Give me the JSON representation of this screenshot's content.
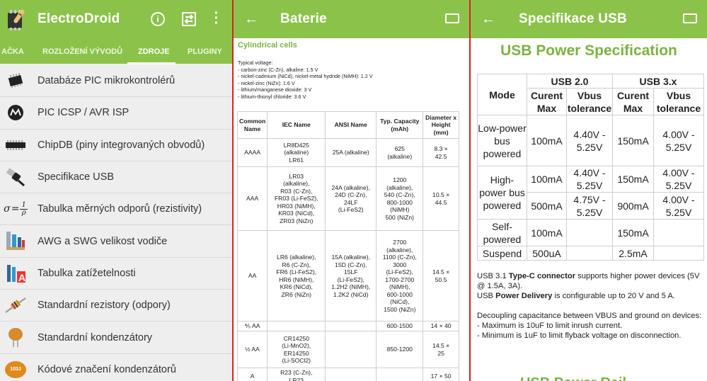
{
  "panel1": {
    "title": "ElectroDroid",
    "tabs": [
      "AČKA",
      "ROZLOŽENÍ VÝVODŮ",
      "ZDROJE",
      "PLUGINY"
    ],
    "active_tab": "ZDROJE",
    "items": [
      {
        "label": "Databáze PIC mikrokontrolérů",
        "icon": "microcontroller-chip-icon"
      },
      {
        "label": "PIC ICSP / AVR ISP",
        "icon": "microchip-logo-icon"
      },
      {
        "label": "ChipDB (piny integrovaných obvodů)",
        "icon": "ic-chip-icon"
      },
      {
        "label": "Specifikace USB",
        "icon": "usb-plug-icon"
      },
      {
        "label": "Tabulka měrných odporů (rezistivity)",
        "icon": "resistivity-formula-icon"
      },
      {
        "label": "AWG a SWG velikost vodiče",
        "icon": "wire-gauge-icon"
      },
      {
        "label": "Tabulka zatížetelnosti",
        "icon": "ampacity-wires-icon"
      },
      {
        "label": "Standardní rezistory (odpory)",
        "icon": "resistor-icon"
      },
      {
        "label": "Standardní kondenzátory",
        "icon": "ceramic-capacitor-icon"
      },
      {
        "label": "Kódové značení kondenzátorů",
        "icon": "capacitor-code-icon"
      }
    ],
    "formula": {
      "sigma": "σ",
      "eq": "=",
      "num": "1",
      "den": "ρ"
    },
    "cap_code": "103J"
  },
  "panel2": {
    "title": "Baterie",
    "section": "Cylindrical cells",
    "voltage_heading": "Typical voltage:",
    "voltages": [
      "- carbon-zinc (C-Zn), alkaline: 1.5 V",
      "- nickel-cadmium (NiCd), nickel-metal hydride (NiMH): 1.2 V",
      "- nickel-zinc (NiZn): 1.6 V",
      "- lithium/manganese dioxide: 3 V",
      "- lithium-thionyl chloride: 3.6 V"
    ],
    "headers": [
      "Common Name",
      "IEC Name",
      "ANSI Name",
      "Typ. Capacity (mAh)",
      "Diameter x Height (mm)"
    ],
    "rows": [
      [
        "AAAA",
        "LR8D425\n(alkaline)\nLR61",
        "25A (alkaline)",
        "625\n(alkaline)",
        "8.3 ×\n42.5"
      ],
      [
        "AAA",
        "LR03\n(alkaline),\nR03 (C-Zn),\nFR03 (Li-FeS2),\nHR03 (NiMH),\nKR03 (NiCd),\nZR03 (NiZn)",
        "24A (alkaline),\n24D (C-Zn),\n24LF\n(Li-FeS2)",
        "1200\n(alkaline),\n540 (C-Zn),\n800-1000\n(NiMH)\n500 (NiZn)",
        "10.5 ×\n44.5"
      ],
      [
        "AA",
        "LR6 (alkaline),\nR6 (C-Zn),\nFR6 (Li-FeS2),\nHR6 (NiMH),\nKR6 (NiCd),\nZR6 (NiZn)",
        "15A (alkaline),\n15D (C-Zn),\n15LF\n(Li-FeS2),\n1.2H2 (NiMH),\n1.2K2 (NiCd)",
        "2700\n(alkaline),\n1100 (C-Zn),\n3000\n(Li-FeS2),\n1700-2700\n(NiMH),\n600-1000\n(NiCd),\n1500 (NiZn)",
        "14.5 ×\n50.5"
      ],
      [
        "⅘ AA",
        "",
        "",
        "600-1500",
        "14 × 40"
      ],
      [
        "½ AA",
        "CR14250\n(Li-MnO2),\nER14250\n(Li-SOCl2)",
        "",
        "850-1200",
        "14.5 ×\n25"
      ],
      [
        "A",
        "R23 (C-Zn),\nLR23",
        "",
        "",
        "17 × 50"
      ]
    ],
    "zoom_out": "−",
    "zoom_in": "+"
  },
  "panel3": {
    "title": "Specifikace USB",
    "heading": "USB Power Specification",
    "h_mode": "Mode",
    "h_usb2": "USB 2.0",
    "h_usb3": "USB 3.x",
    "h_cur": "Curent Max",
    "h_vbus": "Vbus tolerance",
    "rows": [
      {
        "mode": "Low-power bus powered",
        "c2": "100mA",
        "v2": "4.40V - 5.25V",
        "c3": "150mA",
        "v3": "4.00V - 5.25V"
      },
      {
        "mode": "High-power bus powered",
        "c2": "100mA",
        "v2": "4.40V - 5.25V",
        "c3": "150mA",
        "v3": "4.00V - 5.25V"
      },
      {
        "mode": "",
        "c2": "500mA",
        "v2": "4.75V - 5.25V",
        "c3": "900mA",
        "v3": "4.00V - 5.25V"
      },
      {
        "mode": "Self-powered",
        "c2": "100mA",
        "v2": "",
        "c3": "150mA",
        "v3": ""
      },
      {
        "mode": "Suspend",
        "c2": "500uA",
        "v2": "",
        "c3": "2.5mA",
        "v3": ""
      }
    ],
    "note1a": "USB 3.1 ",
    "note1b": "Type-C connector",
    "note1c": " supports higher power devices (5V @ 1.5A, 3A).",
    "note2a": "USB ",
    "note2b": "Power Delivery",
    "note2c": " is configurable up to 20 V and 5 A.",
    "note3": "Decoupling capacitance between VBUS and ground on devices:",
    "note4": "- Maximum is 10uF to limit inrush current.",
    "note5": "- Minimum is 1uF to limit flyback voltage on disconnection.",
    "cutoff": "USB Power Rail"
  },
  "colors": {
    "accent": "#8bc34a",
    "section": "#7cb342",
    "separator": "#e02020"
  }
}
